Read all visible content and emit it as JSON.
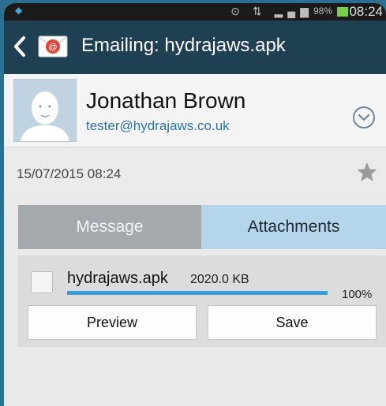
{
  "status_bar": {
    "battery_text": "98%",
    "time": "08:24",
    "battery_color": "#7bd04a"
  },
  "action_bar": {
    "back_icon": "chevron-left-icon",
    "app_icon": "email-app-icon",
    "title": "Emailing: hydrajaws.apk",
    "background": "#1f3f52"
  },
  "sender": {
    "name": "Jonathan Brown",
    "email": "tester@hydrajaws.co.uk",
    "avatar_icon": "default-avatar-icon",
    "expand_icon": "chevron-down-circle-icon"
  },
  "message_meta": {
    "date": "15/07/2015  08:24",
    "star_icon": "star-icon"
  },
  "tabs": [
    {
      "label": "Message",
      "active": false
    },
    {
      "label": "Attachments",
      "active": true
    }
  ],
  "attachment": {
    "file_name": "hydrajaws.apk",
    "file_size": "2020.0 KB",
    "progress_percent": 100,
    "progress_label": "100%",
    "preview_label": "Preview",
    "save_label": "Save",
    "accent": "#3a9ed6"
  }
}
